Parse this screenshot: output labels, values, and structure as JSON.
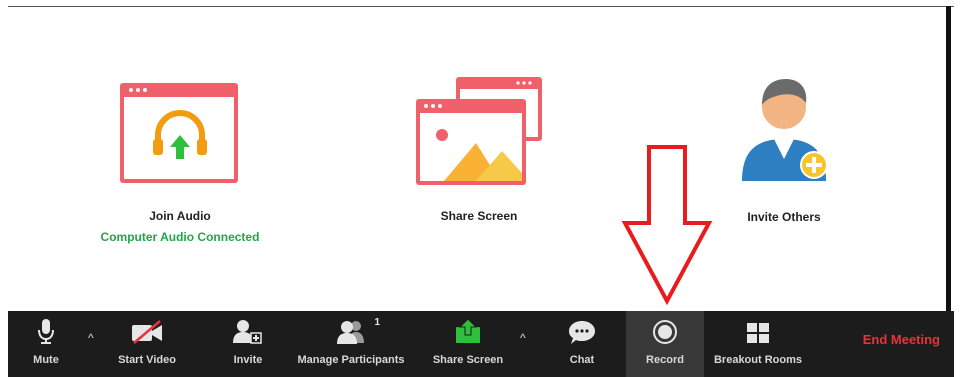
{
  "actions": {
    "join_audio": {
      "label": "Join Audio",
      "status": "Computer Audio Connected"
    },
    "share_screen": {
      "label": "Share Screen"
    },
    "invite_others": {
      "label": "Invite Others"
    }
  },
  "toolbar": {
    "mute": "Mute",
    "start_video": "Start Video",
    "invite": "Invite",
    "manage_participants": "Manage Participants",
    "participant_count": "1",
    "share_screen": "Share Screen",
    "chat": "Chat",
    "record": "Record",
    "breakout_rooms": "Breakout Rooms",
    "end_meeting": "End Meeting",
    "caret": "^"
  },
  "colors": {
    "accent_red": "#e8333c",
    "connected_green": "#22a64a",
    "share_green": "#2fbf3a",
    "toolbar_bg": "#1c1c1c",
    "window_red": "#f0606a",
    "annotation_arrow": "#e81c1c"
  }
}
